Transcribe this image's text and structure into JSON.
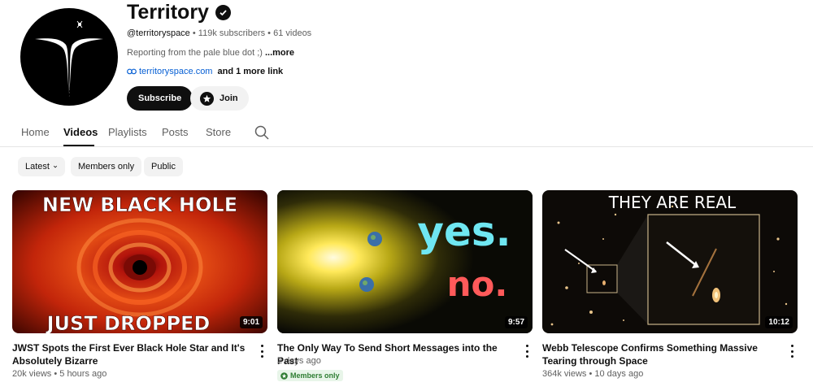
{
  "channel": {
    "name": "Territory",
    "handle": "@territoryspace",
    "subscribers": "119k subscribers",
    "videos_count": "61 videos",
    "separator": " • ",
    "description": "Reporting from the pale blue dot ;) ",
    "more_label": "...more",
    "link_text": "territoryspace.com",
    "more_links": "and 1 more link",
    "subscribe_label": "Subscribe",
    "join_label": "Join"
  },
  "tabs": [
    {
      "label": "Home"
    },
    {
      "label": "Videos"
    },
    {
      "label": "Playlists"
    },
    {
      "label": "Posts"
    },
    {
      "label": "Store"
    }
  ],
  "chips": [
    {
      "label": "Latest"
    },
    {
      "label": "Members only"
    },
    {
      "label": "Public"
    }
  ],
  "videos": [
    {
      "title": "JWST Spots the First Ever Black Hole Star and It's Absolutely Bizarre",
      "views": "20k views",
      "age": "5 hours ago",
      "duration": "9:01",
      "thumb_top": "NEW BLACK HOLE",
      "thumb_bottom": "JUST DROPPED"
    },
    {
      "title": "The Only Way To Send Short Messages into the Past",
      "age": "2 days ago",
      "badge": "Members only",
      "duration": "9:57",
      "thumb_yes": "yes.",
      "thumb_no": "no."
    },
    {
      "title": "Webb Telescope Confirms Something Massive Tearing through Space",
      "views": "364k views",
      "age": "10 days ago",
      "duration": "10:12",
      "thumb_top": "THEY ARE REAL"
    }
  ],
  "colors": {
    "accent_link": "#065fd4",
    "members_green": "#2e7d32",
    "yes_cyan": "#6fe7f2",
    "no_red": "#ff5a5a"
  }
}
